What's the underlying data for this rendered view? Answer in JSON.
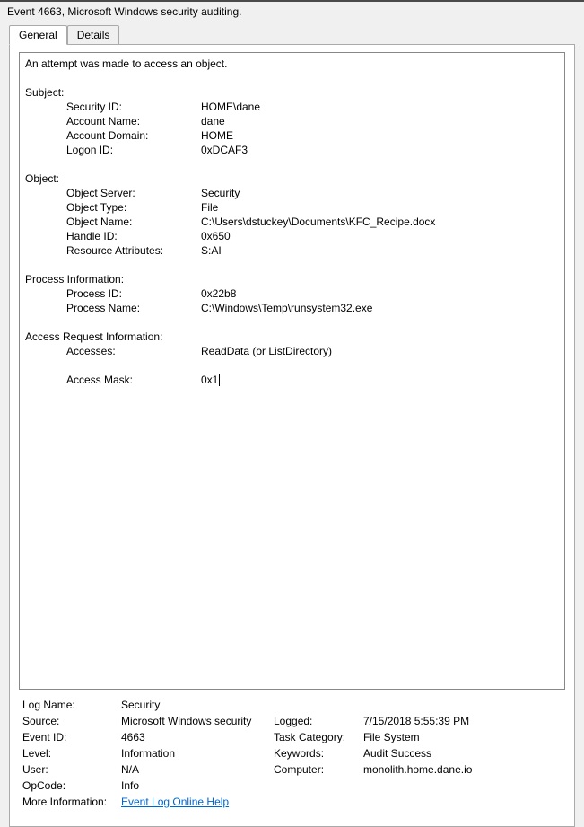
{
  "title": "Event 4663, Microsoft Windows security auditing.",
  "tabs": {
    "general": "General",
    "details": "Details"
  },
  "event_body": {
    "opening": "An attempt was made to access an object.",
    "subject_header": "Subject:",
    "subject": {
      "security_id_label": "Security ID:",
      "security_id_value": "HOME\\dane",
      "account_name_label": "Account Name:",
      "account_name_value": "dane",
      "account_domain_label": "Account Domain:",
      "account_domain_value": "HOME",
      "logon_id_label": "Logon ID:",
      "logon_id_value": "0xDCAF3"
    },
    "object_header": "Object:",
    "object": {
      "object_server_label": "Object Server:",
      "object_server_value": "Security",
      "object_type_label": "Object Type:",
      "object_type_value": "File",
      "object_name_label": "Object Name:",
      "object_name_value": "C:\\Users\\dstuckey\\Documents\\KFC_Recipe.docx",
      "handle_id_label": "Handle ID:",
      "handle_id_value": "0x650",
      "resource_attrs_label": "Resource Attributes:",
      "resource_attrs_value": "S:AI"
    },
    "process_header": "Process Information:",
    "process": {
      "process_id_label": "Process ID:",
      "process_id_value": "0x22b8",
      "process_name_label": "Process Name:",
      "process_name_value": "C:\\Windows\\Temp\\runsystem32.exe"
    },
    "access_header": "Access Request Information:",
    "access": {
      "accesses_label": "Accesses:",
      "accesses_value": "ReadData (or ListDirectory)",
      "access_mask_label": "Access Mask:",
      "access_mask_value": "0x1"
    }
  },
  "meta": {
    "log_name_label": "Log Name:",
    "log_name_value": "Security",
    "source_label": "Source:",
    "source_value": "Microsoft Windows security",
    "logged_label": "Logged:",
    "logged_value": "7/15/2018 5:55:39 PM",
    "event_id_label": "Event ID:",
    "event_id_value": "4663",
    "task_category_label": "Task Category:",
    "task_category_value": "File System",
    "level_label": "Level:",
    "level_value": "Information",
    "keywords_label": "Keywords:",
    "keywords_value": "Audit Success",
    "user_label": "User:",
    "user_value": "N/A",
    "computer_label": "Computer:",
    "computer_value": "monolith.home.dane.io",
    "opcode_label": "OpCode:",
    "opcode_value": "Info",
    "more_info_label": "More Information:",
    "more_info_link": "Event Log Online Help"
  }
}
